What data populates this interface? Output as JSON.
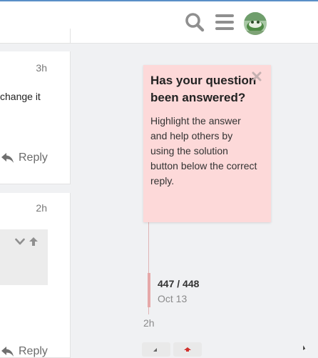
{
  "header": {
    "icons": [
      "search-icon",
      "hamburger-menu-icon",
      "user-avatar"
    ]
  },
  "posts": [
    {
      "date": "3h",
      "text": "change it",
      "reply_label": "Reply"
    },
    {
      "date": "2h",
      "reply_label": "Reply"
    }
  ],
  "popup": {
    "title": "Has your question been answered?",
    "body": "Highlight the answer and help others by using the solution button below the correct reply.",
    "close_icon": "close-icon",
    "background": "#fdd9d9"
  },
  "timeline": {
    "position": "447 / 448",
    "date": "Oct 13",
    "last_activity": "2h",
    "accent": "#e6a8a8"
  },
  "colors": {
    "accent": "#5a8fc7",
    "danger": "#d0302c"
  }
}
